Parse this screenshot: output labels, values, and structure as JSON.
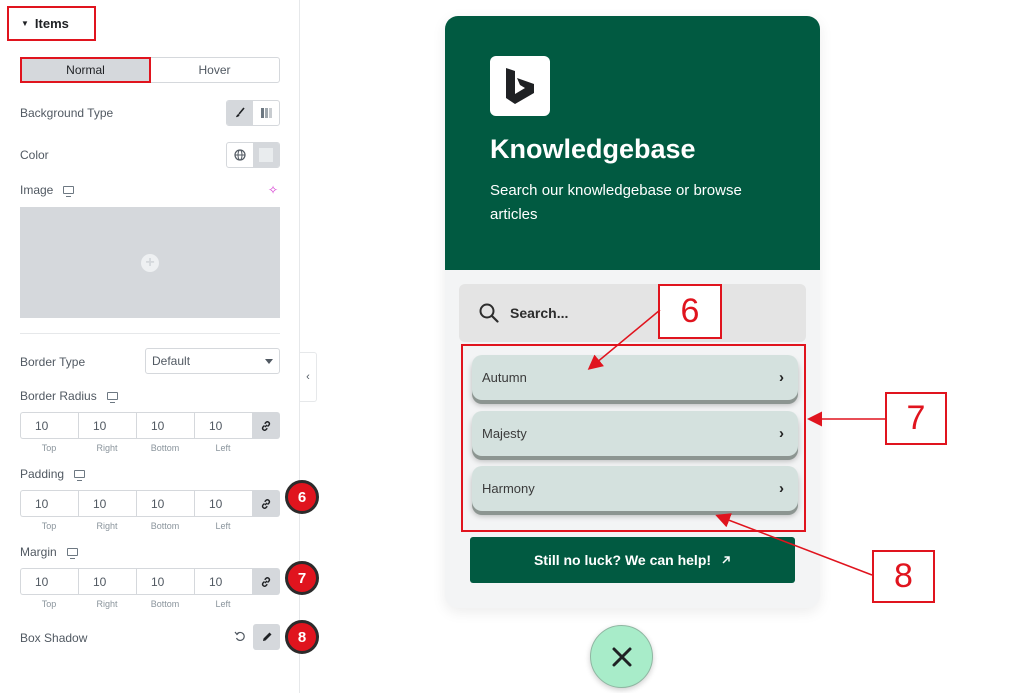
{
  "panel": {
    "section_title": "Items",
    "tabs": [
      {
        "label": "Normal",
        "active": true
      },
      {
        "label": "Hover",
        "active": false
      }
    ],
    "background_type_label": "Background Type",
    "color_label": "Color",
    "image_label": "Image",
    "border_type_label": "Border Type",
    "border_type_value": "Default",
    "border_radius_label": "Border Radius",
    "border_radius": {
      "top": "10",
      "right": "10",
      "bottom": "10",
      "left": "10"
    },
    "padding_label": "Padding",
    "padding": {
      "top": "10",
      "right": "10",
      "bottom": "10",
      "left": "10"
    },
    "margin_label": "Margin",
    "margin": {
      "top": "10",
      "right": "10",
      "bottom": "10",
      "left": "10"
    },
    "dim_labels": {
      "top": "Top",
      "right": "Right",
      "bottom": "Bottom",
      "left": "Left"
    },
    "box_shadow_label": "Box Shadow",
    "badges": {
      "padding": "6",
      "margin": "7",
      "box_shadow": "8"
    }
  },
  "widget": {
    "title": "Knowledgebase",
    "subtitle": "Search our knowledgebase or browse articles",
    "search_placeholder": "Search...",
    "items": [
      {
        "label": "Autumn"
      },
      {
        "label": "Majesty"
      },
      {
        "label": "Harmony"
      }
    ],
    "cta_label": "Still no luck? We can help!",
    "colors": {
      "brand": "#015a41",
      "item_bg": "#d4e1de",
      "fab": "#a8ecc9"
    }
  },
  "callouts": {
    "c6": "6",
    "c7": "7",
    "c8": "8"
  },
  "icons": [
    "caret-down-icon",
    "brush-icon",
    "gradient-icon",
    "globe-icon",
    "desktop-icon",
    "sparkle-icon",
    "plus-icon",
    "link-icon",
    "reset-icon",
    "pencil-icon",
    "search-icon",
    "chevron-right-icon",
    "arrow-up-right-icon",
    "close-icon",
    "bing-logo"
  ],
  "accent": "#e0141e"
}
